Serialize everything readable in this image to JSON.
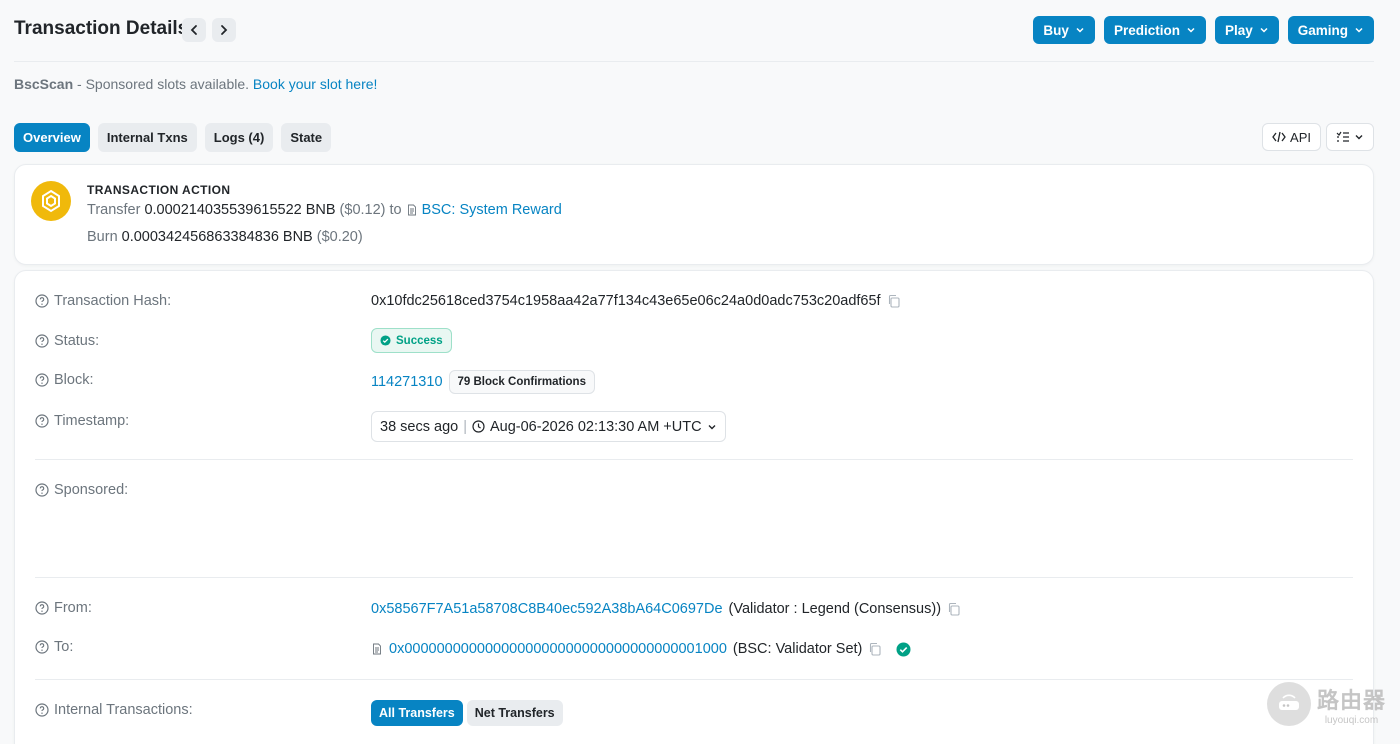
{
  "header": {
    "title": "Transaction Details",
    "menu": [
      {
        "label": "Buy"
      },
      {
        "label": "Prediction"
      },
      {
        "label": "Play"
      },
      {
        "label": "Gaming"
      }
    ]
  },
  "sponsor": {
    "brand": "BscScan",
    "text": " - Sponsored slots available. ",
    "link": "Book your slot here!"
  },
  "tabs": [
    "Overview",
    "Internal Txns",
    "Logs (4)",
    "State"
  ],
  "tools": {
    "api_label": "API"
  },
  "action": {
    "title": "TRANSACTION ACTION",
    "transfer_word": "Transfer",
    "transfer_amount": "0.000214035539615522 BNB",
    "transfer_usd": "($0.12)",
    "to_word": "to",
    "transfer_to": "BSC: System Reward",
    "burn_word": "Burn",
    "burn_amount": "0.000342456863384836 BNB",
    "burn_usd": "($0.20)"
  },
  "details": {
    "hash_label": "Transaction Hash:",
    "hash": "0x10fdc25618ced3754c1958aa42a77f134c43e65e06c24a0d0adc753c20adf65f",
    "status_label": "Status:",
    "status": "Success",
    "block_label": "Block:",
    "block": "114271310",
    "confirmations": "79 Block Confirmations",
    "timestamp_label": "Timestamp:",
    "time_ago": "38 secs ago",
    "sep": "|",
    "timestamp": "Aug-06-2026 02:13:30 AM +UTC",
    "sponsored_label": "Sponsored:",
    "from_label": "From:",
    "from_addr": "0x58567F7A51a58708C8B40ec592A38bA64C0697De",
    "from_name": "(Validator : Legend (Consensus))",
    "to_label": "To:",
    "to_addr": "0x0000000000000000000000000000000000001000",
    "to_name": "(BSC: Validator Set)",
    "internal_label": "Internal Transactions:",
    "all_transfers": "All Transfers",
    "net_transfers": "Net Transfers"
  },
  "watermark": {
    "big": "路由器",
    "small": "luyouqi.com"
  },
  "colors": {
    "accent": "#0784c3",
    "success": "#00a186",
    "bnb": "#f0b90b"
  }
}
